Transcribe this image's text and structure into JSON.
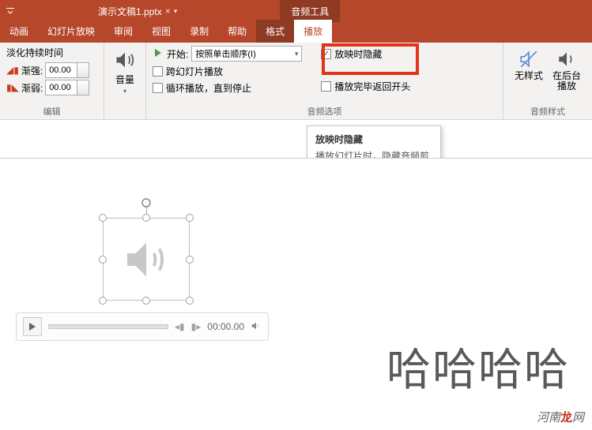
{
  "titlebar": {
    "filename": "演示文稿1.pptx",
    "dirty_marker": "×",
    "contextual_tab": "音频工具"
  },
  "tabs": {
    "items": [
      "动画",
      "幻灯片放映",
      "审阅",
      "视图",
      "录制",
      "帮助",
      "格式",
      "播放"
    ],
    "active": "播放"
  },
  "ribbon": {
    "edit_group": {
      "title": "淡化持续时间",
      "fade_in_label": "渐强:",
      "fade_in_value": "00.00",
      "fade_out_label": "渐弱:",
      "fade_out_value": "00.00",
      "label": "编辑"
    },
    "volume": {
      "label": "音量"
    },
    "audio_options": {
      "start_label": "开始:",
      "start_value": "按照单击顺序(I)",
      "cross_slides": "跨幻灯片播放",
      "loop": "循环播放，直到停止",
      "hide_during_show": "放映时隐藏",
      "rewind": "播放完毕返回开头",
      "hide_checked": true,
      "label": "音频选项"
    },
    "audio_styles": {
      "no_style": "无样式",
      "background": "在后台播放",
      "label": "音频样式"
    }
  },
  "tooltip": {
    "title": "放映时隐藏",
    "body": "播放幻灯片时，隐藏音频剪辑图标。"
  },
  "player": {
    "time": "00:00.00"
  },
  "slide": {
    "text": "哈哈哈哈"
  },
  "watermark": {
    "prefix": "河南",
    "accent": "龙",
    "suffix": "网"
  }
}
